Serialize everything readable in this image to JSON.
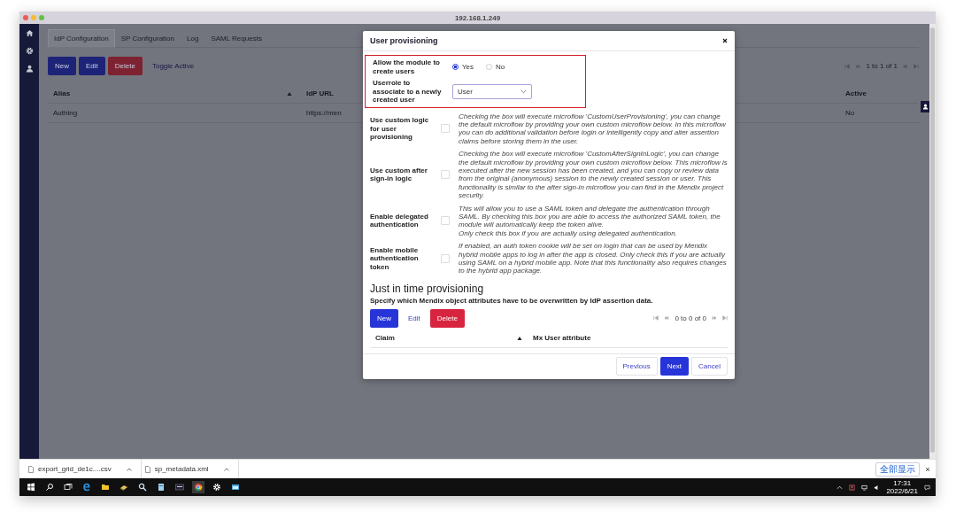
{
  "window": {
    "title": "192.168.1.249"
  },
  "tabs": [
    {
      "label": "IdP Configuration",
      "selected": true
    },
    {
      "label": "SP Configuration",
      "selected": false
    },
    {
      "label": "Log",
      "selected": false
    },
    {
      "label": "SAML Requests",
      "selected": false
    }
  ],
  "toolbar": [
    {
      "label": "New",
      "kind": "primary"
    },
    {
      "label": "Edit",
      "kind": "primary"
    },
    {
      "label": "Delete",
      "kind": "danger"
    },
    {
      "label": "Toggle Active",
      "kind": "link"
    }
  ],
  "pagination": "1 to 1 of 1",
  "table": {
    "columns": [
      "Alias",
      "IdP URL",
      "Active"
    ],
    "rows": [
      [
        "Authing",
        "https://men",
        "No"
      ]
    ]
  },
  "dialog": {
    "title": "User provisioning",
    "highlighted_fields": [
      {
        "kind": "radio",
        "label": "Allow the module to create users",
        "options": [
          {
            "label": "Yes",
            "selected": true
          },
          {
            "label": "No",
            "selected": false
          }
        ]
      },
      {
        "kind": "select",
        "label": "Userrole to associate to a newly created user",
        "value": "User"
      }
    ],
    "fields": [
      {
        "kind": "checkbox",
        "label": "Use custom logic for user provisioning",
        "checked": false,
        "help": "Checking the box will execute microflow 'CustomUserProvisioning', you can change the default microflow by providing your own custom microflow below. In this microflow you can do additional validation before login or intelligently copy and alter assertion claims before storing them in the user."
      },
      {
        "kind": "checkbox",
        "label": "Use custom after sign-in logic",
        "checked": false,
        "help": "Checking the box will execute microflow 'CustomAfterSignInLogic', you can change the default microflow by providing your own custom microflow below. This microflow is executed after the new session has been created, and you can copy or review data from the original (anonymous) session to the newly created session or user. This functionality is similar to the after sign-in microflow you can find in the Mendix project security."
      },
      {
        "kind": "checkbox",
        "label": "Enable delegated authentication",
        "checked": false,
        "help": "This will allow you to use a SAML token and delegate the authentication through SAML. By checking this box you are able to access the authorized SAML token, the module will automatically keep the token alive.\nOnly check this box if you are actually using delegated authentication."
      },
      {
        "kind": "checkbox",
        "label": "Enable mobile authentication token",
        "checked": false,
        "help": "If enabled, an auth token cookie will be set on login that can be used by Mendix hybrid mobile apps to log in after the app is closed. Only check this if you are actually using SAML on a hybrid mobile app. Note that this functionality also requires changes to the hybrid app package."
      }
    ],
    "section": {
      "title": "Just in time provisioning",
      "description": "Specify which Mendix object attributes have to be overwritten by IdP assertion data.",
      "buttons": [
        {
          "label": "New",
          "kind": "primary"
        },
        {
          "label": "Edit",
          "kind": "link"
        },
        {
          "label": "Delete",
          "kind": "danger"
        }
      ],
      "pagination": "0 to 0 of 0",
      "columns": [
        "Claim",
        "Mx User attribute"
      ]
    },
    "footer_buttons": [
      {
        "label": "Previous",
        "kind": "secondary"
      },
      {
        "label": "Next",
        "kind": "primary"
      },
      {
        "label": "Cancel",
        "kind": "secondary"
      }
    ]
  },
  "downloads": [
    {
      "name": "export_grid_de1c....csv"
    },
    {
      "name": "sp_metadata.xml"
    }
  ],
  "show_all": "全部显示",
  "taskbar": {
    "time": "17:31",
    "date": "2022/6/21"
  }
}
